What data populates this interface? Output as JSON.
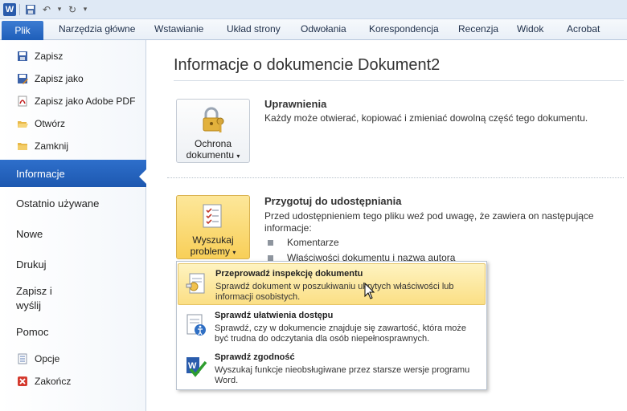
{
  "qat": {
    "logo_letter": "W",
    "save_icon": "save-icon",
    "undo_icon": "undo-icon",
    "redo_icon": "redo-icon",
    "customize_icon": "customize-icon"
  },
  "tabs": {
    "file": "Plik",
    "items": [
      "Narzędzia główne",
      "Wstawianie",
      "Układ strony",
      "Odwołania",
      "Korespondencja",
      "Recenzja",
      "Widok",
      "Acrobat"
    ]
  },
  "nav": {
    "small_top": [
      {
        "label": "Zapisz",
        "icon": "save-icon"
      },
      {
        "label": "Zapisz jako",
        "icon": "save-as-icon"
      },
      {
        "label": "Zapisz jako Adobe PDF",
        "icon": "pdf-icon"
      },
      {
        "label": "Otwórz",
        "icon": "open-folder-icon"
      },
      {
        "label": "Zamknij",
        "icon": "close-folder-icon"
      }
    ],
    "active": "Informacje",
    "big": [
      "Ostatnio używane",
      "Nowe",
      "Drukuj",
      "Zapisz i\nwyślij",
      "Pomoc"
    ],
    "small_bottom": [
      {
        "label": "Opcje",
        "icon": "options-icon"
      },
      {
        "label": "Zakończ",
        "icon": "exit-icon"
      }
    ]
  },
  "main": {
    "title": "Informacje o dokumencie Dokument2",
    "permissions": {
      "button_line1": "Ochrona",
      "button_line2": "dokumentu",
      "heading": "Uprawnienia",
      "text": "Każdy może otwierać, kopiować i zmieniać dowolną część tego dokumentu."
    },
    "prepare": {
      "button_line1": "Wyszukaj",
      "button_line2": "problemy",
      "heading": "Przygotuj do udostępniania",
      "text": "Przed udostępnieniem tego pliku weź pod uwagę, że zawiera on następujące informacje:",
      "bullets": [
        "Komentarze",
        "Właściwości dokumentu i nazwa autora"
      ]
    }
  },
  "menu": {
    "items": [
      {
        "title": "Przeprowadź inspekcję dokumentu",
        "desc": "Sprawdź dokument w poszukiwaniu ukrytych właściwości lub informacji osobistych.",
        "icon": "inspect-document-icon"
      },
      {
        "title": "Sprawdź ułatwienia dostępu",
        "desc": "Sprawdź, czy w dokumencie znajduje się zawartość, która może być trudna do odczytania dla osób niepełnosprawnych.",
        "icon": "accessibility-icon"
      },
      {
        "title": "Sprawdź zgodność",
        "desc": "Wyszukaj funkcje nieobsługiwane przez starsze wersje programu Word.",
        "icon": "compatibility-icon"
      }
    ]
  },
  "colors": {
    "accent": "#1d58b0",
    "highlight": "#fbdf85"
  }
}
